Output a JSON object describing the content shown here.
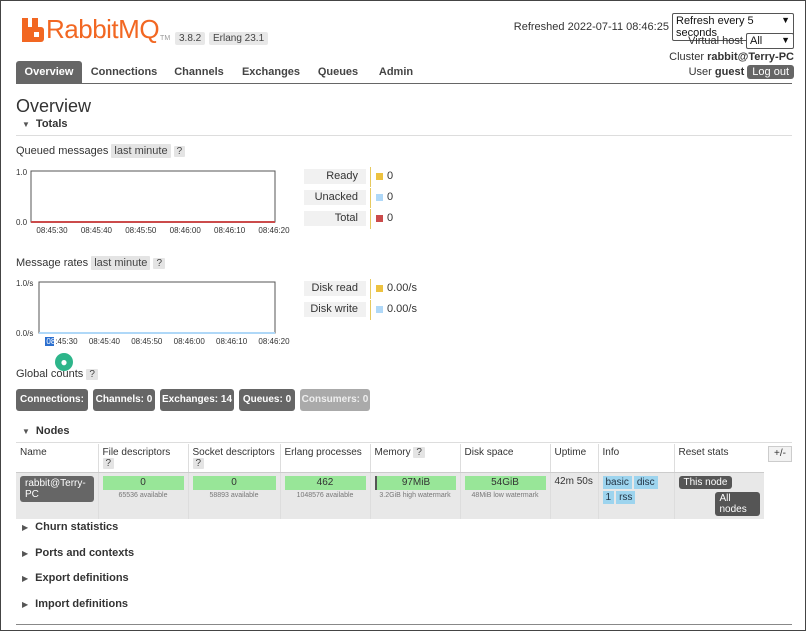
{
  "header": {
    "brand": "RabbitMQ",
    "trademark": "TM",
    "rabbitmq_version": "3.8.2",
    "erlang_version": "Erlang 23.1",
    "refreshed_label": "Refreshed",
    "refreshed_time": "2022-07-11 08:46:25",
    "refresh_select": "Refresh every 5 seconds",
    "vhost_label": "Virtual host",
    "vhost_select": "All",
    "cluster_label": "Cluster",
    "cluster_name": "rabbit@Terry-PC",
    "user_label": "User",
    "user_name": "guest",
    "logout_label": "Log out"
  },
  "tabs": [
    "Overview",
    "Connections",
    "Channels",
    "Exchanges",
    "Queues",
    "Admin"
  ],
  "page_title": "Overview",
  "totals": {
    "section_label": "Totals",
    "queued": {
      "label": "Queued messages",
      "range": "last minute",
      "help": "?",
      "y_top": "1.0",
      "y_bottom": "0.0",
      "x_ticks": [
        "08:45:30",
        "08:45:40",
        "08:45:50",
        "08:46:00",
        "08:46:10",
        "08:46:20"
      ],
      "legend": [
        {
          "name": "Ready",
          "value": "0",
          "color": "#edc240"
        },
        {
          "name": "Unacked",
          "value": "0",
          "color": "#afd8f8"
        },
        {
          "name": "Total",
          "value": "0",
          "color": "#cb4b4b"
        }
      ]
    },
    "rates": {
      "label": "Message rates",
      "range": "last minute",
      "help": "?",
      "y_top": "1.0/s",
      "y_bottom": "0.0/s",
      "x_ticks": [
        "08:45:30",
        "08:45:40",
        "08:45:50",
        "08:46:00",
        "08:46:10",
        "08:46:20"
      ],
      "selected_tick_prefix": "08",
      "selected_tick_rest": ":45:30",
      "legend": [
        {
          "name": "Disk read",
          "value": "0.00/s",
          "color": "#edc240"
        },
        {
          "name": "Disk write",
          "value": "0.00/s",
          "color": "#afd8f8"
        }
      ]
    }
  },
  "global_counts": {
    "label": "Global counts",
    "help": "?",
    "badges": [
      {
        "label": "Connections:",
        "value": "0"
      },
      {
        "label": "Channels:",
        "value": "0"
      },
      {
        "label": "Exchanges:",
        "value": "14"
      },
      {
        "label": "Queues:",
        "value": "0"
      },
      {
        "label": "Consumers:",
        "value": "0"
      }
    ]
  },
  "nodes": {
    "section_label": "Nodes",
    "headers": {
      "name": "Name",
      "file_desc": "File descriptors",
      "socket_desc": "Socket descriptors",
      "erlang_proc": "Erlang processes",
      "memory": "Memory",
      "disk": "Disk space",
      "uptime": "Uptime",
      "info": "Info",
      "reset": "Reset stats"
    },
    "help": "?",
    "plusminus": "+/-",
    "row": {
      "name": "rabbit@Terry-PC",
      "file_desc_value": "0",
      "file_desc_sub": "65536 available",
      "socket_desc_value": "0",
      "socket_desc_sub": "58893 available",
      "erlang_proc_value": "462",
      "erlang_proc_sub": "1048576 available",
      "memory_value": "97MiB",
      "memory_sub": "3.2GiB high watermark",
      "disk_value": "54GiB",
      "disk_sub": "48MiB low watermark",
      "uptime": "42m 50s",
      "info_tags": [
        "basic",
        "disc",
        "1",
        "rss"
      ],
      "reset_this": "This node",
      "reset_all": "All nodes"
    }
  },
  "collapsed_sections": [
    "Churn statistics",
    "Ports and contexts",
    "Export definitions",
    "Import definitions"
  ],
  "colors": {
    "brand": "#f26722",
    "tab_active": "#666666",
    "gauge_green": "#98e698",
    "info_blue": "#9dd4ee"
  }
}
